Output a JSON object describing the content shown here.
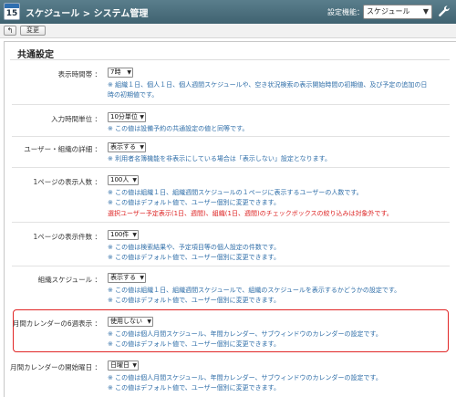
{
  "app": {
    "day": "15",
    "title": "スケジュール > システム管理",
    "function_label": "設定機能：",
    "function_value": "スケジュール"
  },
  "toolbar": {
    "back_label": "↰",
    "change_label": "変更"
  },
  "section": {
    "title": "共通設定"
  },
  "rows": [
    {
      "label": "表示時間帯 ：",
      "value": "7時",
      "notes": [
        "※ 組織１日、個人１日、個人週間スケジュールや、空き状況検索の表示開始時間の初期値、及び予定の追加の日",
        "時の初期値です。"
      ]
    },
    {
      "label": "入力時間単位 ：",
      "value": "10分単位",
      "notes": [
        "※ この値は設備予約の共通設定の値と同等です。"
      ]
    },
    {
      "label": "ユーザー・組織の詳細 ：",
      "value": "表示する",
      "notes": [
        "※ 利用者名簿機能を非表示にしている場合は「表示しない」設定となります。"
      ]
    },
    {
      "label": "1ページの表示人数 ：",
      "value": "100人",
      "notes": [
        "※ この値は組織１日、組織週間スケジュールの１ページに表示するユーザーの人数です。",
        "※ この値はデフォルト値で、ユーザー個別に変更できます。"
      ],
      "warning": "選択ユーザー予定表示(1日、週間)、組織(1日、週間)のチェックボックスの絞り込みは対象外です。"
    },
    {
      "label": "1ページの表示件数 ：",
      "value": "100件",
      "notes": [
        "※ この値は検索結果や、予定項目等の個人設定の件数です。",
        "※ この値はデフォルト値で、ユーザー個別に変更できます。"
      ]
    },
    {
      "label": "組織スケジュール ：",
      "value": "表示する",
      "notes": [
        "※ この値は組織１日、組織週間スケジュールで、組織のスケジュールを表示するかどうかの設定です。",
        "※ この値はデフォルト値で、ユーザー個別に変更できます。"
      ]
    },
    {
      "label": "月間カレンダーの6週表示 ：",
      "value": "使用しない",
      "notes": [
        "※ この値は個人月間スケジュール、年間カレンダー、サブウィンドウのカレンダーの設定です。",
        "※ この値はデフォルト値で、ユーザー個別に変更できます。"
      ]
    },
    {
      "label": "月間カレンダーの開始曜日 ：",
      "value": "日曜日",
      "notes": [
        "※ この値は個人月間スケジュール、年間カレンダー、サブウィンドウのカレンダーの設定です。",
        "※ この値はデフォルト値で、ユーザー個別に変更できます。"
      ]
    }
  ]
}
